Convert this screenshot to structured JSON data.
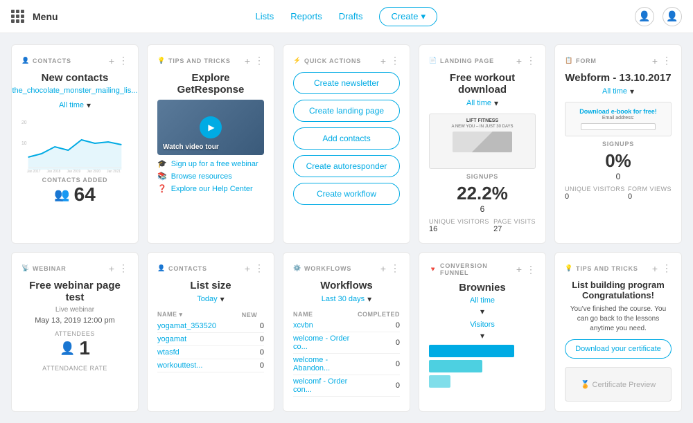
{
  "nav": {
    "menu_label": "Menu",
    "links": [
      "Lists",
      "Reports",
      "Drafts"
    ],
    "create_label": "Create"
  },
  "cards": {
    "contacts": {
      "label": "CONTACTS",
      "title": "New contacts",
      "link_text": "the_chocolate_monster_mailing_lis...",
      "filter": "All time",
      "contacts_added_label": "CONTACTS ADDED",
      "contacts_added_value": "64"
    },
    "explore": {
      "label": "TIPS AND TRICKS",
      "title": "Explore GetResponse",
      "video_label": "Watch video tour",
      "links": [
        "Sign up for a free webinar",
        "Browse resources",
        "Explore our Help Center"
      ]
    },
    "quick_actions": {
      "label": "QUICK ACTIONS",
      "actions": [
        "Create newsletter",
        "Create landing page",
        "Add contacts",
        "Create autoresponder",
        "Create workflow"
      ]
    },
    "landing_page": {
      "label": "LANDING PAGE",
      "title": "Free workout download",
      "filter": "All time",
      "preview_title": "LIFT FITNESS",
      "preview_sub": "A NEW YOU – IN JUST 30 DAYS",
      "signups_label": "SIGNUPS",
      "signups_value": "22.2%",
      "signups_count": "6",
      "unique_visitors_label": "UNIQUE VISITORS",
      "unique_visitors_value": "16",
      "page_visits_label": "PAGE VISITS",
      "page_visits_value": "27"
    },
    "webform": {
      "label": "FORM",
      "title": "Webform - 13.10.2017",
      "filter": "All time",
      "preview_title": "Download e-book for free!",
      "preview_sub": "Email address:",
      "signups_label": "SIGNUPS",
      "signups_value": "0%",
      "signups_count": "0",
      "unique_visitors_label": "UNIQUE VISITORS",
      "unique_visitors_value": "0",
      "form_views_label": "FORM VIEWS",
      "form_views_value": "0"
    },
    "webinar": {
      "label": "WEBINAR",
      "title": "Free webinar page test",
      "type": "Live webinar",
      "date": "May 13, 2019 12:00 pm",
      "attendees_label": "ATTENDEES",
      "attendees_value": "1",
      "attendance_label": "ATTENDANCE RATE"
    },
    "list_size": {
      "label": "CONTACTS",
      "title": "List size",
      "filter": "Today",
      "col_name": "NAME",
      "col_new": "NEW",
      "rows": [
        {
          "name": "yogamat_353520",
          "value": "0"
        },
        {
          "name": "yogamat",
          "value": "0"
        },
        {
          "name": "wtasfd",
          "value": "0"
        },
        {
          "name": "workouttest...",
          "value": "0"
        }
      ]
    },
    "workflows": {
      "label": "WORKFLOWS",
      "title": "Workflows",
      "filter": "Last 30 days",
      "col_name": "NAME",
      "col_completed": "COMPLETED",
      "rows": [
        {
          "name": "xcvbn",
          "value": "0"
        },
        {
          "name": "welcome - Order co...",
          "value": "0"
        },
        {
          "name": "welcome - Abandon...",
          "value": "0"
        },
        {
          "name": "welcomf - Order con...",
          "value": "0"
        }
      ]
    },
    "conversion_funnel": {
      "label": "CONVERSION FUNNEL",
      "title": "Brownies",
      "filter1": "All time",
      "filter2": "Visitors"
    },
    "tips2": {
      "label": "TIPS AND TRICKS",
      "title": "List building program",
      "subtitle": "Congratulations!",
      "body": "You've finished the course. You can go back to the lessons anytime you need.",
      "btn_label": "Download your certificate"
    }
  }
}
